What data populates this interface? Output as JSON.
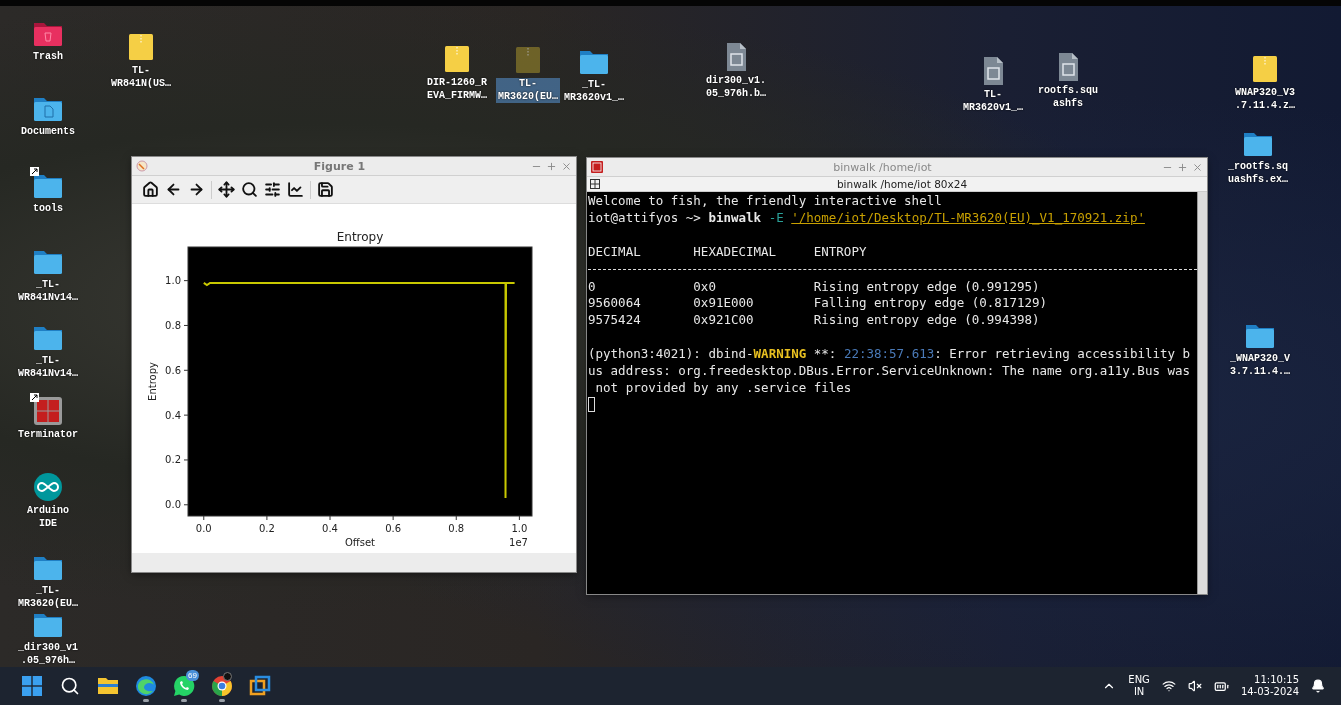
{
  "desktop": {
    "icons": [
      {
        "kind": "trash",
        "label": "Trash",
        "selected": false,
        "shortcut": false
      },
      {
        "kind": "documents",
        "label": "Documents",
        "selected": false,
        "shortcut": false
      },
      {
        "kind": "folder",
        "label": "tools",
        "selected": false,
        "shortcut": true
      },
      {
        "kind": "folder",
        "label": "_TL-\nWR841Nv14…",
        "selected": false,
        "shortcut": false
      },
      {
        "kind": "folder",
        "label": "_TL-\nWR841Nv14…",
        "selected": false,
        "shortcut": false
      },
      {
        "kind": "terminator",
        "label": "Terminator",
        "selected": false,
        "shortcut": true
      },
      {
        "kind": "arduino",
        "label": "Arduino\nIDE",
        "selected": false,
        "shortcut": false
      },
      {
        "kind": "folder",
        "label": "_TL-\nMR3620(EU…",
        "selected": false,
        "shortcut": false
      },
      {
        "kind": "folder",
        "label": "_dir300_v1\n.05_976h…",
        "selected": false,
        "shortcut": false
      },
      {
        "kind": "zip",
        "label": "TL-\nWR841N(US…",
        "selected": false,
        "shortcut": false
      },
      {
        "kind": "zip",
        "label": "DIR-1260_R\nEVA_FIRMW…",
        "selected": false,
        "shortcut": false
      },
      {
        "kind": "zip",
        "label": "TL-\nMR3620(EU…",
        "selected": true,
        "shortcut": false
      },
      {
        "kind": "folder",
        "label": "_TL-\nMR3620v1_…",
        "selected": false,
        "shortcut": false
      },
      {
        "kind": "file",
        "label": "dir300_v1.\n05_976h.b…",
        "selected": false,
        "shortcut": false
      },
      {
        "kind": "file",
        "label": "TL-\nMR3620v1_…",
        "selected": false,
        "shortcut": false
      },
      {
        "kind": "file",
        "label": "rootfs.squ\nashfs",
        "selected": false,
        "shortcut": false
      },
      {
        "kind": "zip",
        "label": "WNAP320_V3\n.7.11.4.z…",
        "selected": false,
        "shortcut": false
      },
      {
        "kind": "folder",
        "label": "_rootfs.sq\nuashfs.ex…",
        "selected": false,
        "shortcut": false
      },
      {
        "kind": "folder",
        "label": "_WNAP320_V\n3.7.11.4.…",
        "selected": false,
        "shortcut": false
      }
    ]
  },
  "figure_window": {
    "title": "Figure 1",
    "chart_data": {
      "type": "line",
      "title": "Entropy",
      "xlabel": "Offset",
      "ylabel": "Entropy",
      "x": [
        0,
        0.01,
        0.02,
        0.956,
        0.956,
        0.9575,
        0.985
      ],
      "series": [
        {
          "color": "#c8c800",
          "values": [
            0.99,
            0.98,
            0.99,
            0.99,
            0.03,
            0.99,
            0.99
          ]
        }
      ],
      "xlim": [
        -0.05,
        1.04
      ],
      "ylim": [
        -0.05,
        1.15
      ],
      "xticks": [
        {
          "value": 0,
          "label": "0.0"
        },
        {
          "value": 0.2,
          "label": "0.2"
        },
        {
          "value": 0.4,
          "label": "0.4"
        },
        {
          "value": 0.6,
          "label": "0.6"
        },
        {
          "value": 0.8,
          "label": "0.8"
        },
        {
          "value": 1,
          "label": "1.0"
        }
      ],
      "yticks": [
        {
          "value": 0,
          "label": "0.0"
        },
        {
          "value": 0.2,
          "label": "0.2"
        },
        {
          "value": 0.4,
          "label": "0.4"
        },
        {
          "value": 0.6,
          "label": "0.6"
        },
        {
          "value": 0.8,
          "label": "0.8"
        },
        {
          "value": 1,
          "label": "1.0"
        }
      ],
      "annotations": [
        {
          "text": "1e7"
        }
      ]
    }
  },
  "terminal_window": {
    "title": "binwalk  /home/iot",
    "tab": "binwalk  /home/iot 80x24",
    "greeting": "Welcome to fish, the friendly interactive shell",
    "command": {
      "prompt": "iot@attifyos ~> ",
      "program": "binwalk",
      "flag": "-E",
      "argument": "'/home/iot/Desktop/TL-MR3620(EU)_V1_170921.zip'"
    },
    "table": {
      "columns": [
        "DECIMAL",
        "HEXADECIMAL",
        "ENTROPY"
      ],
      "rows": [
        [
          "0",
          "0x0",
          "Rising entropy edge (0.991295)"
        ],
        [
          "9560064",
          "0x91E000",
          "Falling entropy edge (0.817129)"
        ],
        [
          "9575424",
          "0x921C00",
          "Rising entropy edge (0.994398)"
        ]
      ]
    },
    "warning": {
      "source": "(python3:4021): dbind-",
      "level": "WARNING",
      "marker": " **: ",
      "time": "22:38:57.613",
      "message": ": Error retrieving accessibility bus address: org.freedesktop.DBus.Error.ServiceUnknown: The name org.a11y.Bus was not provided by any .service files"
    }
  },
  "taskbar": {
    "apps": [
      {
        "kind": "start",
        "running": false
      },
      {
        "kind": "search",
        "running": false
      },
      {
        "kind": "files",
        "running": false
      },
      {
        "kind": "browser",
        "running": true
      },
      {
        "kind": "chat",
        "running": true,
        "badge": "69"
      },
      {
        "kind": "chrome",
        "running": true,
        "dot": true
      },
      {
        "kind": "vm",
        "running": false
      }
    ],
    "language": {
      "code": "ENG",
      "region": "IN"
    },
    "time": "11:10:15",
    "date": "14-03-2024"
  }
}
